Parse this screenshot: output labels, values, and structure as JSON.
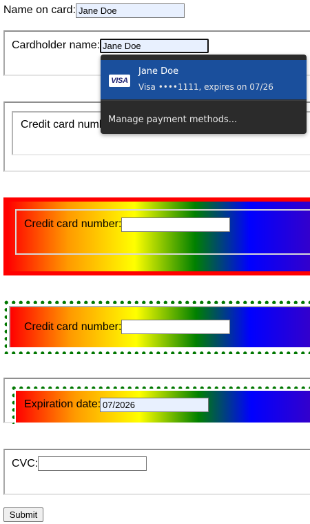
{
  "fields": {
    "name_on_card": {
      "label": "Name on card:",
      "value": "Jane Doe"
    },
    "cardholder_name": {
      "label": "Cardholder name:",
      "value": "Jane Doe"
    },
    "credit_card_number_1": {
      "label": "Credit card number:",
      "value": ""
    },
    "credit_card_number_2": {
      "label": "Credit card number:",
      "value": ""
    },
    "credit_card_number_3": {
      "label": "Credit card number:",
      "value": ""
    },
    "expiration_date": {
      "label": "Expiration date:",
      "value": "07/2026"
    },
    "cvc": {
      "label": "CVC:",
      "value": ""
    }
  },
  "autofill_dropdown": {
    "suggestion": {
      "card_brand": "VISA",
      "name": "Jane Doe",
      "details": "Visa  ••••1111, expires on 07/26"
    },
    "manage_label": "Manage payment methods..."
  },
  "submit": {
    "label": "Submit"
  },
  "colors": {
    "autofill_background": "#e8f0fe",
    "dropdown_background": "#2b2b2b",
    "dropdown_selected": "#1a4f9c",
    "dotted_border": "#007700",
    "red_border": "#ff0000"
  },
  "icons": {
    "card_brand_icon": "visa-logo"
  }
}
